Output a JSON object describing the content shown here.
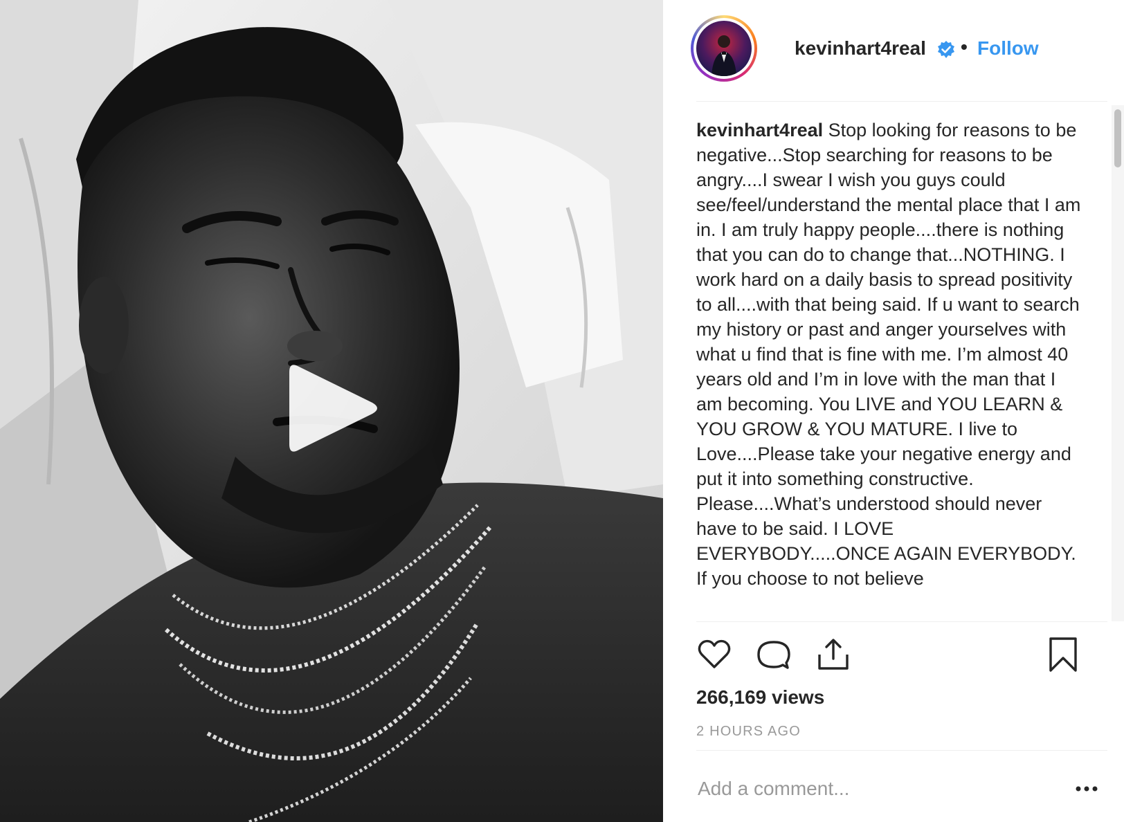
{
  "post": {
    "username": "kevinhart4real",
    "follow_label": "Follow",
    "separator": "•",
    "caption_username": "kevinhart4real",
    "caption_text": "Stop looking for reasons to be negative...Stop searching for reasons to be angry....I swear I wish you guys could see/feel/understand the mental place that I am in. I am truly happy people....there is nothing that you can do to change that...NOTHING. I work hard on a daily basis to spread positivity to all....with that being said. If u want to search my history or past and anger yourselves with what u find that is fine with me. I’m almost 40 years old and I’m in love with the man that I am becoming. You LIVE and YOU LEARN & YOU GROW & YOU MATURE. I live to Love....Please take your negative energy and put it into something constructive. Please....What’s understood should never have to be said. I LOVE EVERYBODY.....ONCE AGAIN EVERYBODY. If you choose to not believe",
    "views": "266,169 views",
    "timestamp": "2 HOURS AGO"
  },
  "comment": {
    "placeholder": "Add a comment..."
  },
  "icons": {
    "play": "play-icon",
    "verified": "verified-badge-icon",
    "like": "heart-icon",
    "comment": "comment-bubble-icon",
    "share": "share-icon",
    "save": "bookmark-icon",
    "more": "more-horizontal-icon"
  },
  "colors": {
    "link_blue": "#3897f0",
    "text": "#262626",
    "muted": "#999999",
    "divider": "#efefef"
  }
}
